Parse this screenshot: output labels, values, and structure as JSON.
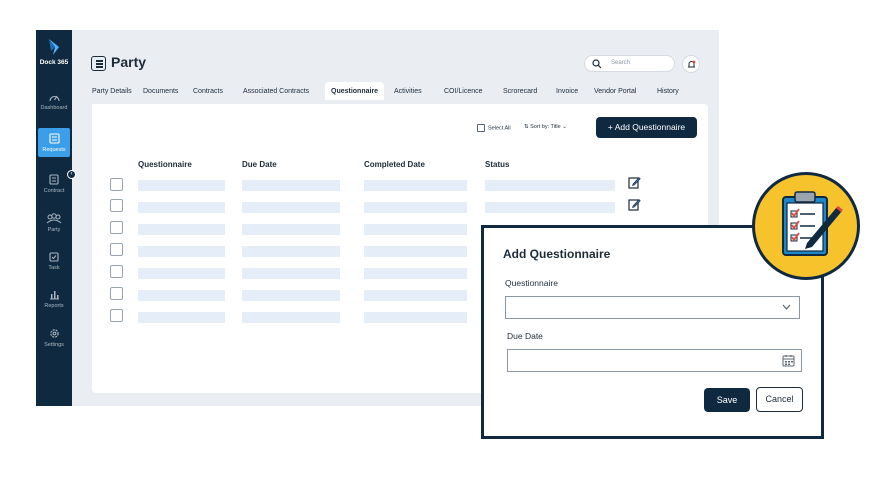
{
  "brand": {
    "name": "Dock 365"
  },
  "sidebar": {
    "items": [
      {
        "label": "Dashboard",
        "icon": "dashboard-icon"
      },
      {
        "label": "Requests",
        "icon": "requests-icon",
        "active": true
      },
      {
        "label": "Contract",
        "icon": "contract-icon"
      },
      {
        "label": "Party",
        "icon": "party-icon"
      },
      {
        "label": "Task",
        "icon": "task-icon"
      },
      {
        "label": "Reports",
        "icon": "reports-icon"
      },
      {
        "label": "Settings",
        "icon": "settings-icon"
      }
    ]
  },
  "header": {
    "title": "Party",
    "search_placeholder": "Search"
  },
  "tabs": [
    {
      "label": "Party Details"
    },
    {
      "label": "Documents"
    },
    {
      "label": "Contracts"
    },
    {
      "label": "Associated Contracts"
    },
    {
      "label": "Questionnaire",
      "active": true
    },
    {
      "label": "Activities"
    },
    {
      "label": "COI/Licence"
    },
    {
      "label": "Scrorecard"
    },
    {
      "label": "Invoice"
    },
    {
      "label": "Vendor Portal"
    },
    {
      "label": "History"
    }
  ],
  "toolbar": {
    "select_all": "Select All",
    "sort": "Sort by: Title",
    "add_button": "Add Questionnaire"
  },
  "table": {
    "columns": [
      "Questionnaire",
      "Due Date",
      "Completed Date",
      "Status"
    ],
    "row_count": 7
  },
  "modal": {
    "title": "Add Questionnaire",
    "questionnaire_label": "Questionnaire",
    "due_date_label": "Due Date",
    "save_label": "Save",
    "cancel_label": "Cancel"
  },
  "colors": {
    "sidebar": "#0f2a40",
    "accent": "#3a9ee8",
    "badge": "#f6c32c",
    "placeholder_bar": "#e4edf8"
  }
}
